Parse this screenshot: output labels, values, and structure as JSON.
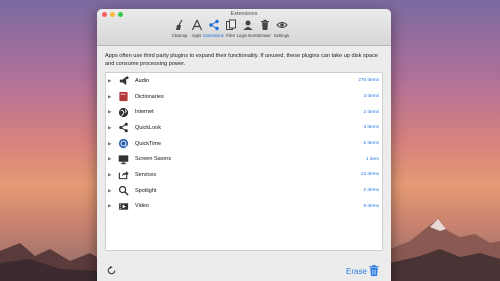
{
  "window": {
    "title": "Extensions"
  },
  "toolbar": [
    {
      "label": "Cleanup",
      "icon": "broom-icon"
    },
    {
      "label": "Apps",
      "icon": "apps-icon"
    },
    {
      "label": "Extensions",
      "icon": "share-icon",
      "active": true
    },
    {
      "label": "Files",
      "icon": "files-icon"
    },
    {
      "label": "Login Items",
      "icon": "person-icon"
    },
    {
      "label": "Eraser",
      "icon": "trash-icon"
    },
    {
      "label": "Settings",
      "icon": "eye-icon"
    }
  ],
  "description": "Apps often use third party plugins to expand their functionality. If unused, these plugins can take up disk space and consume processing power.",
  "items": [
    {
      "name": "Audio",
      "count": "276 items",
      "icon": "audio-icon"
    },
    {
      "name": "Dictionaries",
      "count": "3 items",
      "icon": "dictionary-icon"
    },
    {
      "name": "Internet",
      "count": "2 items",
      "icon": "globe-icon"
    },
    {
      "name": "QuickLook",
      "count": "3 items",
      "icon": "share-icon"
    },
    {
      "name": "QuickTime",
      "count": "5 items",
      "icon": "quicktime-icon"
    },
    {
      "name": "Screen Savers",
      "count": "1 item",
      "icon": "monitor-icon"
    },
    {
      "name": "Services",
      "count": "24 items",
      "icon": "export-icon"
    },
    {
      "name": "Spotlight",
      "count": "2 items",
      "icon": "magnifier-icon"
    },
    {
      "name": "Video",
      "count": "9 items",
      "icon": "film-icon"
    }
  ],
  "footer": {
    "erase_label": "Erase"
  },
  "colors": {
    "accent": "#2a7ae2"
  }
}
